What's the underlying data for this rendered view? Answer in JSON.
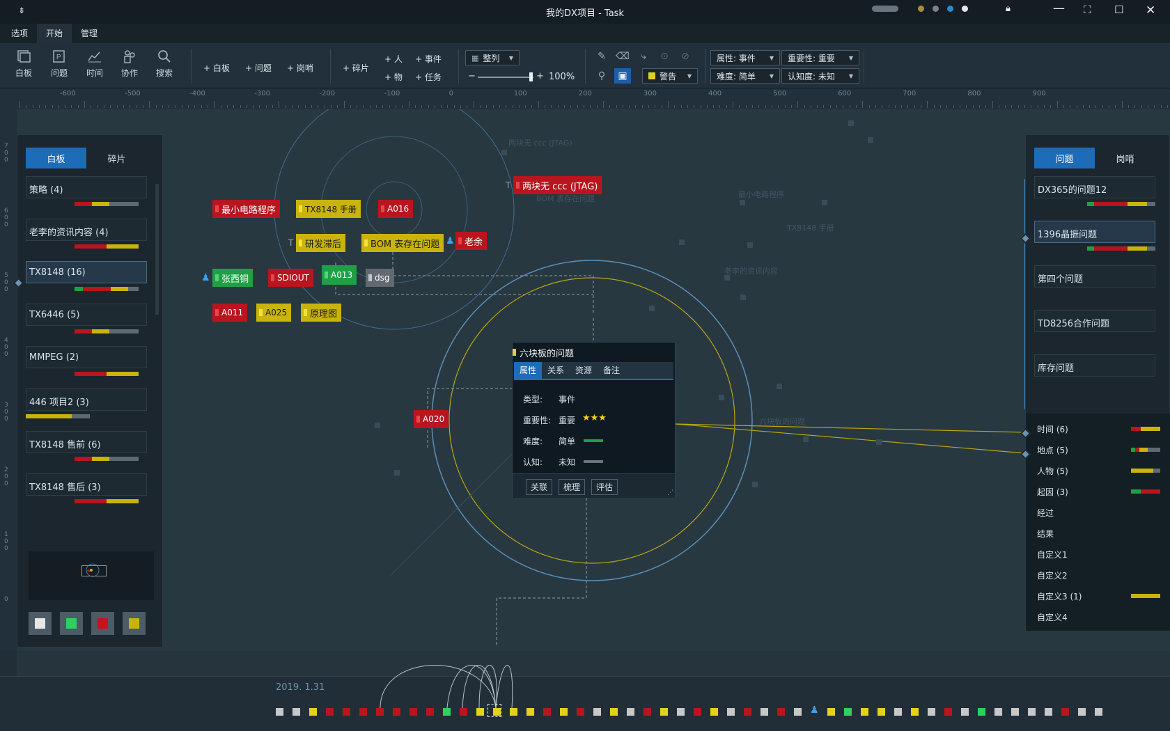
{
  "window": {
    "title": "我的DX项目 - Task"
  },
  "menus": [
    "选项",
    "开始",
    "管理"
  ],
  "ribbon": {
    "views": [
      "白板",
      "问题",
      "时间",
      "协作",
      "搜索"
    ],
    "add_group1": [
      "+ 白板",
      "+ 问题",
      "+ 岗哨"
    ],
    "add_fragment": "+ 碎片",
    "add_group2": [
      "+ 人",
      "+ 事件",
      "+ 物",
      "+ 任务"
    ],
    "arrange": "整列",
    "zoom": "100%",
    "alert_combo": "警告",
    "filters": [
      "属性: 事件",
      "重要性: 重要",
      "难度: 简单",
      "认知度: 未知"
    ]
  },
  "ruler": {
    "top_labels": [
      "-600",
      "-500",
      "-400",
      "-300",
      "-200",
      "-100",
      "0",
      "100",
      "200",
      "300",
      "400",
      "500",
      "600",
      "700",
      "800",
      "900"
    ],
    "left_labels": [
      "7\n0\n0",
      "6\n0\n0",
      "5\n0\n0",
      "4\n0\n0",
      "3\n0\n0",
      "2\n0\n0",
      "1\n0\n0",
      "0"
    ]
  },
  "left_panel": {
    "tabs": [
      "白板",
      "碎片"
    ],
    "items": [
      {
        "label": "策略 (4)",
        "bar": [
          "#b8151f",
          "#c9b40d",
          "#5e6a72"
        ]
      },
      {
        "label": "老李的资讯内容 (4)",
        "bar": [
          "#b8151f",
          "#c9b40d"
        ]
      },
      {
        "label": "TX8148 (16)",
        "bar": [
          "#1fa046",
          "#b8151f",
          "#c9b40d",
          "#5e6a72"
        ]
      },
      {
        "label": "TX6446 (5)",
        "bar": [
          "#b8151f",
          "#c9b40d",
          "#5e6a72"
        ]
      },
      {
        "label": "MMPEG (2)",
        "bar": [
          "#b8151f",
          "#c9b40d"
        ]
      },
      {
        "label": "446 项目2 (3)",
        "bar": [
          "#c9b40d",
          "#5e6a72"
        ]
      },
      {
        "label": "TX8148 售前 (6)",
        "bar": [
          "#b8151f",
          "#c9b40d",
          "#5e6a72"
        ]
      },
      {
        "label": "TX8148 售后 (3)",
        "bar": [
          "#b8151f",
          "#c9b40d"
        ]
      }
    ],
    "swatches": [
      "#e6e6e6",
      "#2fd05f",
      "#c8131c",
      "#c9b40d"
    ]
  },
  "tags": [
    {
      "text": "两块无 ccc (JTAG)",
      "color": "red",
      "prefix": "T"
    },
    {
      "text": "最小电路程序",
      "color": "red"
    },
    {
      "text": "TX8148 手册",
      "color": "yel"
    },
    {
      "text": "A016",
      "color": "red"
    },
    {
      "text": "研发滞后",
      "color": "yel",
      "prefix": "T"
    },
    {
      "text": "BOM 表存在问题",
      "color": "yel"
    },
    {
      "text": "老余",
      "color": "red",
      "person": true
    },
    {
      "text": "张西铜",
      "color": "grn",
      "person": true
    },
    {
      "text": "SDIOUT",
      "color": "red"
    },
    {
      "text": "A013",
      "color": "grn"
    },
    {
      "text": "dsg",
      "color": "gry"
    },
    {
      "text": "A011",
      "color": "red"
    },
    {
      "text": "A025",
      "color": "yel"
    },
    {
      "text": "原理图",
      "color": "yel"
    },
    {
      "text": "A020",
      "color": "red"
    }
  ],
  "ghost_labels": [
    "两块无 ccc (JTAG)",
    "最小电路程序",
    "TX8148 手册",
    "BOM 表存在问题",
    "老李的资讯内容",
    "六块板的问题"
  ],
  "popup": {
    "title": "六块板的问题",
    "tabs": [
      "属性",
      "关系",
      "资源",
      "备注"
    ],
    "rows": [
      {
        "label": "类型:",
        "value": "事件"
      },
      {
        "label": "重要性:",
        "value": "重要",
        "stars": "★★★"
      },
      {
        "label": "难度:",
        "value": "简单"
      },
      {
        "label": "认知:",
        "value": "未知"
      }
    ],
    "buttons": [
      "关联",
      "梳理",
      "评估"
    ]
  },
  "right_panel": {
    "tabs": [
      "问题",
      "岗哨"
    ],
    "items": [
      {
        "label": "DX365的问题12",
        "bar": [
          "#1fa046",
          "#b8151f",
          "#c9b40d",
          "#5e6a72"
        ]
      },
      {
        "label": "1396晶振问题",
        "bar": [
          "#1fa046",
          "#b8151f",
          "#c9b40d",
          "#5e6a72"
        ]
      },
      {
        "label": "第四个问题"
      },
      {
        "label": "TD8256合作问题"
      },
      {
        "label": "库存问题"
      }
    ],
    "dimensions": [
      {
        "label": "时间 (6)",
        "bar": [
          "#b8151f",
          "#c9b40d"
        ]
      },
      {
        "label": "地点 (5)",
        "bar": [
          "#1fa046",
          "#b8151f",
          "#c9b40d",
          "#5e6a72"
        ]
      },
      {
        "label": "人物 (5)",
        "bar": [
          "#c9b40d",
          "#5e6a72"
        ]
      },
      {
        "label": "起因 (3)",
        "bar": [
          "#1fa046",
          "#b8151f"
        ]
      },
      {
        "label": "经过"
      },
      {
        "label": "结果"
      },
      {
        "label": "自定义1"
      },
      {
        "label": "自定义2"
      },
      {
        "label": "自定义3 (1)",
        "bar": [
          "#c9b40d"
        ]
      },
      {
        "label": "自定义4"
      }
    ]
  },
  "timeline": {
    "date": "2019. 1.31",
    "squares": [
      "#c8c8c8",
      "#c8c8c8",
      "#e2d31a",
      "#b8151f",
      "#b8151f",
      "#b8151f",
      "#b8151f",
      "#b8151f",
      "#b8151f",
      "#b8151f",
      "#2fd05f",
      "#b8151f",
      "#e2d31a",
      "#e2d31a",
      "#e2d31a",
      "#e2d31a",
      "#b8151f",
      "#e2d31a",
      "#b8151f",
      "#c8c8c8",
      "#e2d31a",
      "#c8c8c8",
      "#b8151f",
      "#e2d31a",
      "#c8c8c8",
      "#b8151f",
      "#e2d31a",
      "#c8c8c8",
      "#b8151f",
      "#c8c8c8",
      "#b8151f",
      "#c8c8c8",
      "#person",
      "#e2d31a",
      "#2fd05f",
      "#e2d31a",
      "#e2d31a",
      "#c8c8c8",
      "#e2d31a",
      "#c8c8c8",
      "#b8151f",
      "#c8c8c8",
      "#2fd05f",
      "#c8c8c8",
      "#c8c8c8",
      "#c8c8c8",
      "#c8c8c8",
      "#b8151f",
      "#c8c8c8",
      "#c8c8c8"
    ]
  }
}
